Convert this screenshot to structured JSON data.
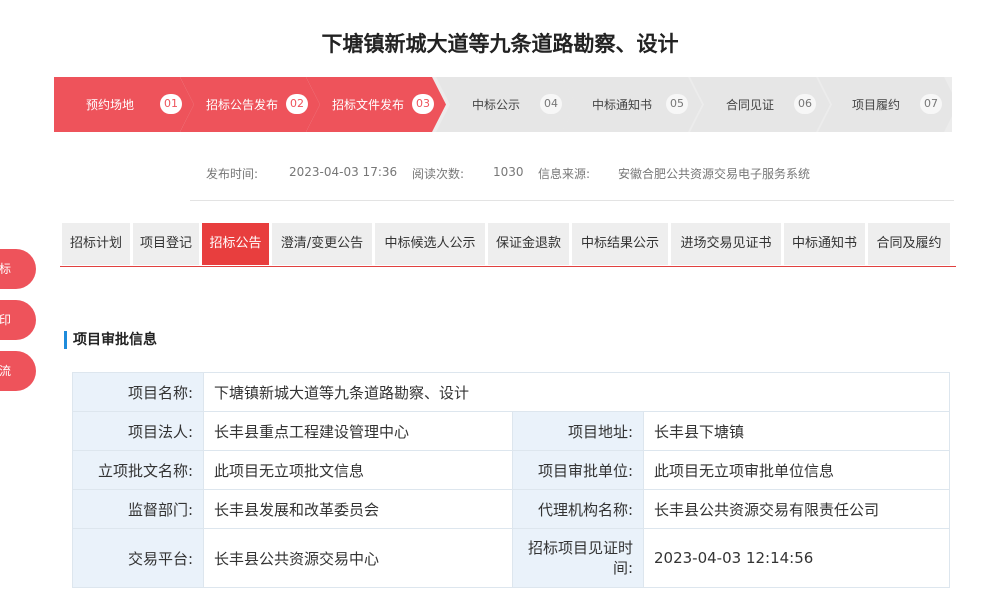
{
  "page_title": "下塘镇新城大道等九条道路勘察、设计",
  "steps": [
    {
      "label": "预约场地",
      "num": "01",
      "state": "active"
    },
    {
      "label": "招标公告发布",
      "num": "02",
      "state": "active"
    },
    {
      "label": "招标文件发布",
      "num": "03",
      "state": "active"
    },
    {
      "label": "中标公示",
      "num": "04",
      "state": "todo"
    },
    {
      "label": "中标通知书",
      "num": "05",
      "state": "todo"
    },
    {
      "label": "合同见证",
      "num": "06",
      "state": "todo"
    },
    {
      "label": "项目履约",
      "num": "07",
      "state": "todo"
    }
  ],
  "meta": {
    "publish_label": "发布时间:",
    "publish_value": "2023-04-03 17:36",
    "views_label": "阅读次数:",
    "views_value": "1030",
    "source_label": "信息来源:",
    "source_value": "安徽合肥公共资源交易电子服务系统"
  },
  "tabs": [
    "招标计划",
    "项目登记",
    "招标公告",
    "澄清/变更公告",
    "中标候选人公示",
    "保证金退款",
    "中标结果公示",
    "进场交易见证书",
    "中标通知书",
    "合同及履约"
  ],
  "active_tab": "招标公告",
  "float_buttons": [
    "标",
    "印",
    "流"
  ],
  "section_title": "项目审批信息",
  "info": {
    "name_label": "项目名称:",
    "name_value": "下塘镇新城大道等九条道路勘察、设计",
    "legal_label": "项目法人:",
    "legal_value": "长丰县重点工程建设管理中心",
    "address_label": "项目地址:",
    "address_value": "长丰县下塘镇",
    "approval_doc_label": "立项批文名称:",
    "approval_doc_value": "此项目无立项批文信息",
    "approval_unit_label": "项目审批单位:",
    "approval_unit_value": "此项目无立项审批单位信息",
    "supervisor_label": "监督部门:",
    "supervisor_value": "长丰县发展和改革委员会",
    "agency_label": "代理机构名称:",
    "agency_value": "长丰县公共资源交易有限责任公司",
    "platform_label": "交易平台:",
    "platform_value": "长丰县公共资源交易中心",
    "witness_time_label": "招标项目见证时间:",
    "witness_time_value": "2023-04-03 12:14:56"
  },
  "colors": {
    "accent": "#ee535b",
    "tab_active": "#e83e3e",
    "section_bar": "#1e8bdb",
    "label_bg": "#eaf2fa"
  }
}
